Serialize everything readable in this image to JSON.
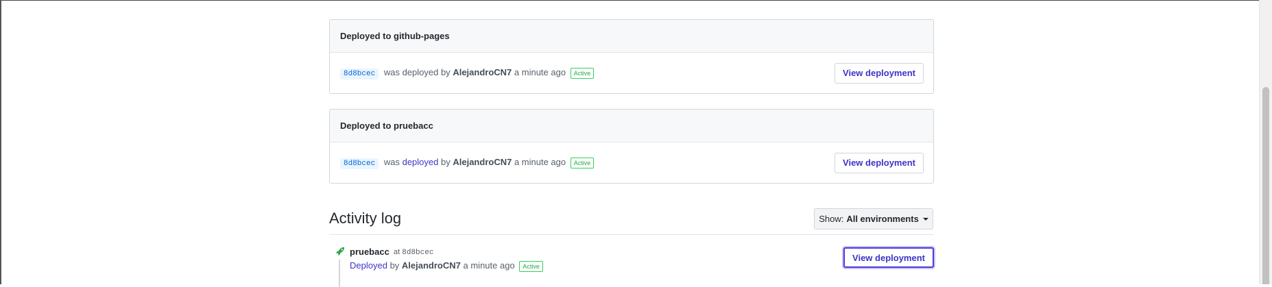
{
  "deployments": [
    {
      "header": "Deployed to github-pages",
      "sha": "8d8bcec",
      "was_text": "was deployed by",
      "author": "AlejandroCN7",
      "time": "a minute ago",
      "status": "Active",
      "button": "View deployment"
    },
    {
      "header": "Deployed to pruebacc",
      "sha": "8d8bcec",
      "was_text": "was",
      "deployed_link": "deployed",
      "by_text": "by",
      "author": "AlejandroCN7",
      "time": "a minute ago",
      "status": "Active",
      "button": "View deployment"
    }
  ],
  "activity": {
    "title": "Activity log",
    "filter_prefix": "Show:",
    "filter_value": "All environments",
    "items": [
      {
        "environment": "pruebacc",
        "at_text": "at",
        "sha": "8d8bcec",
        "action_link": "Deployed",
        "by_text": "by",
        "author": "AlejandroCN7",
        "time": "a minute ago",
        "status": "Active",
        "button": "View deployment",
        "icon": "rocket-icon"
      }
    ]
  },
  "colors": {
    "link": "#3c34c8",
    "active": "#28a745",
    "focus": "#4a3ad8"
  }
}
